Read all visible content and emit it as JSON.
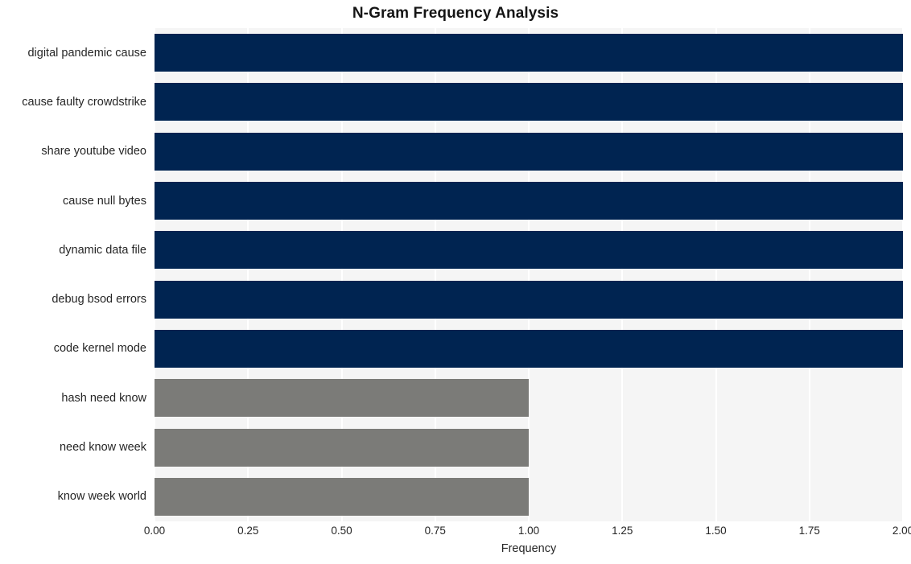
{
  "chart_data": {
    "type": "bar",
    "orientation": "horizontal",
    "title": "N-Gram Frequency Analysis",
    "xlabel": "Frequency",
    "ylabel": "",
    "xlim": [
      0,
      2
    ],
    "xticks": [
      "0.00",
      "0.25",
      "0.50",
      "0.75",
      "1.00",
      "1.25",
      "1.50",
      "1.75",
      "2.00"
    ],
    "xtick_values": [
      0,
      0.25,
      0.5,
      0.75,
      1,
      1.25,
      1.5,
      1.75,
      2
    ],
    "grid": true,
    "grid_axis": "x",
    "legend": "none",
    "categories": [
      "digital pandemic cause",
      "cause faulty crowdstrike",
      "share youtube video",
      "cause null bytes",
      "dynamic data file",
      "debug bsod errors",
      "code kernel mode",
      "hash need know",
      "need know week",
      "know week world"
    ],
    "values": [
      2,
      2,
      2,
      2,
      2,
      2,
      2,
      1,
      1,
      1
    ],
    "bar_colors": [
      "#002451",
      "#002451",
      "#002451",
      "#002451",
      "#002451",
      "#002451",
      "#002451",
      "#7b7b78",
      "#7b7b78",
      "#7b7b78"
    ],
    "colors": {
      "high_frequency": "#002451",
      "low_frequency": "#7b7b78",
      "plot_background": "#f5f5f5",
      "figure_background": "#ffffff",
      "gridline": "#ffffff",
      "text": "#262626",
      "title": "#151515"
    }
  }
}
